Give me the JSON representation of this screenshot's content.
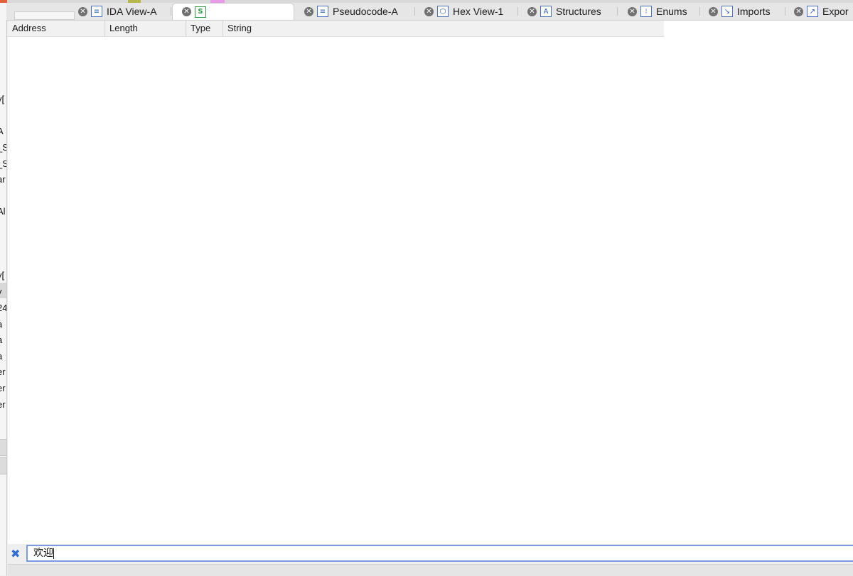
{
  "tabs": [
    {
      "label": "IDA View-A",
      "icon": "ida-view-icon",
      "active": false
    },
    {
      "label": "",
      "icon": "strings-window-icon",
      "active": true
    },
    {
      "label": "Pseudocode-A",
      "icon": "pseudocode-icon",
      "active": false
    },
    {
      "label": "Hex View-1",
      "icon": "hex-view-icon",
      "active": false
    },
    {
      "label": "Structures",
      "icon": "structures-icon",
      "active": false
    },
    {
      "label": "Enums",
      "icon": "enums-icon",
      "active": false
    },
    {
      "label": "Imports",
      "icon": "imports-icon",
      "active": false
    },
    {
      "label": "Expor",
      "icon": "exports-icon",
      "active": false
    }
  ],
  "table": {
    "columns": [
      "Address",
      "Length",
      "Type",
      "String"
    ],
    "rows": []
  },
  "search": {
    "value": "欢迎"
  },
  "left_fragments": [
    "y[",
    "A",
    "_S",
    "_S",
    "ar",
    "Al",
    "y[",
    "y",
    "24",
    "a",
    "a",
    "a",
    "er",
    "er",
    "er"
  ],
  "colors": {
    "accent": "#7a9be0",
    "cancel": "#2e6ed1",
    "active_tab_icon": "#2d9a3e"
  }
}
